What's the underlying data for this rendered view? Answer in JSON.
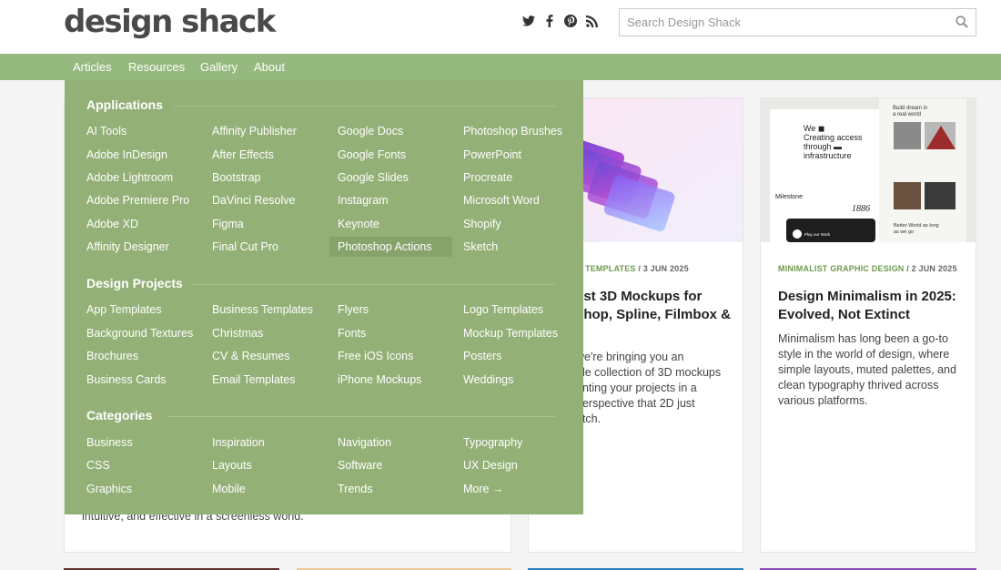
{
  "header": {
    "logo": "design shack",
    "search_placeholder": "Search Design Shack",
    "social_icons": [
      "twitter-icon",
      "facebook-icon",
      "pinterest-icon",
      "rss-icon"
    ]
  },
  "nav": {
    "items": [
      "Articles",
      "Resources",
      "Gallery",
      "About"
    ]
  },
  "colors": {
    "nav_green": "#95b97e",
    "dropdown_green": "#93b077",
    "meta_green": "#6f9a4f"
  },
  "dropdown": {
    "sections": [
      {
        "title": "Applications",
        "columns": [
          [
            "AI Tools",
            "Adobe InDesign",
            "Adobe Lightroom",
            "Adobe Premiere Pro",
            "Adobe XD",
            "Affinity Designer"
          ],
          [
            "Affinity Publisher",
            "After Effects",
            "Bootstrap",
            "DaVinci Resolve",
            "Figma",
            "Final Cut Pro"
          ],
          [
            "Google Docs",
            "Google Fonts",
            "Google Slides",
            "Instagram",
            "Keynote",
            "Photoshop Actions"
          ],
          [
            "Photoshop Brushes",
            "PowerPoint",
            "Procreate",
            "Microsoft Word",
            "Shopify",
            "Sketch"
          ]
        ]
      },
      {
        "title": "Design Projects",
        "columns": [
          [
            "App Templates",
            "Background Textures",
            "Brochures",
            "Business Cards"
          ],
          [
            "Business Templates",
            "Christmas",
            "CV & Resumes",
            "Email Templates"
          ],
          [
            "Flyers",
            "Fonts",
            "Free iOS Icons",
            "iPhone Mockups"
          ],
          [
            "Logo Templates",
            "Mockup Templates",
            "Posters",
            "Weddings"
          ]
        ]
      },
      {
        "title": "Categories",
        "columns": [
          [
            "Business",
            "CSS",
            "Graphics"
          ],
          [
            "Inspiration",
            "Layouts",
            "Mobile"
          ],
          [
            "Navigation",
            "Software",
            "Trends"
          ],
          [
            "Typography",
            "UX Design",
            "More →"
          ]
        ]
      }
    ]
  },
  "cards": {
    "left_tail": "intuitive, and effective in a screenless world.",
    "middle": {
      "category": "TEMPLATES",
      "date": "/ 3 JUN 2025",
      "title_lines": [
        "est 3D Mockups for",
        "shop, Spline, Filmbox &"
      ],
      "text_lines": [
        "we're bringing you an",
        "ble collection of 3D mockups",
        "enting your projects in a",
        "perspective that 2D just",
        "atch."
      ]
    },
    "right": {
      "category": "MINIMALIST GRAPHIC DESIGN",
      "date": "/ 2 JUN 2025",
      "title_lines": [
        "Design Minimalism in 2025:",
        "Evolved, Not Extinct"
      ],
      "text_lines": [
        "Minimalism has long been a go-to",
        "style in the world of design, where",
        "simple layouts, muted palettes, and",
        "clean typography thrived across",
        "various platforms."
      ],
      "image_texts": {
        "headline": "We Creating access through infrastructure",
        "build": "Build dream in a real world",
        "milestone": "Milestone",
        "year": "1886",
        "better": "Better World as long as we go",
        "play": "Play our Work"
      }
    }
  }
}
